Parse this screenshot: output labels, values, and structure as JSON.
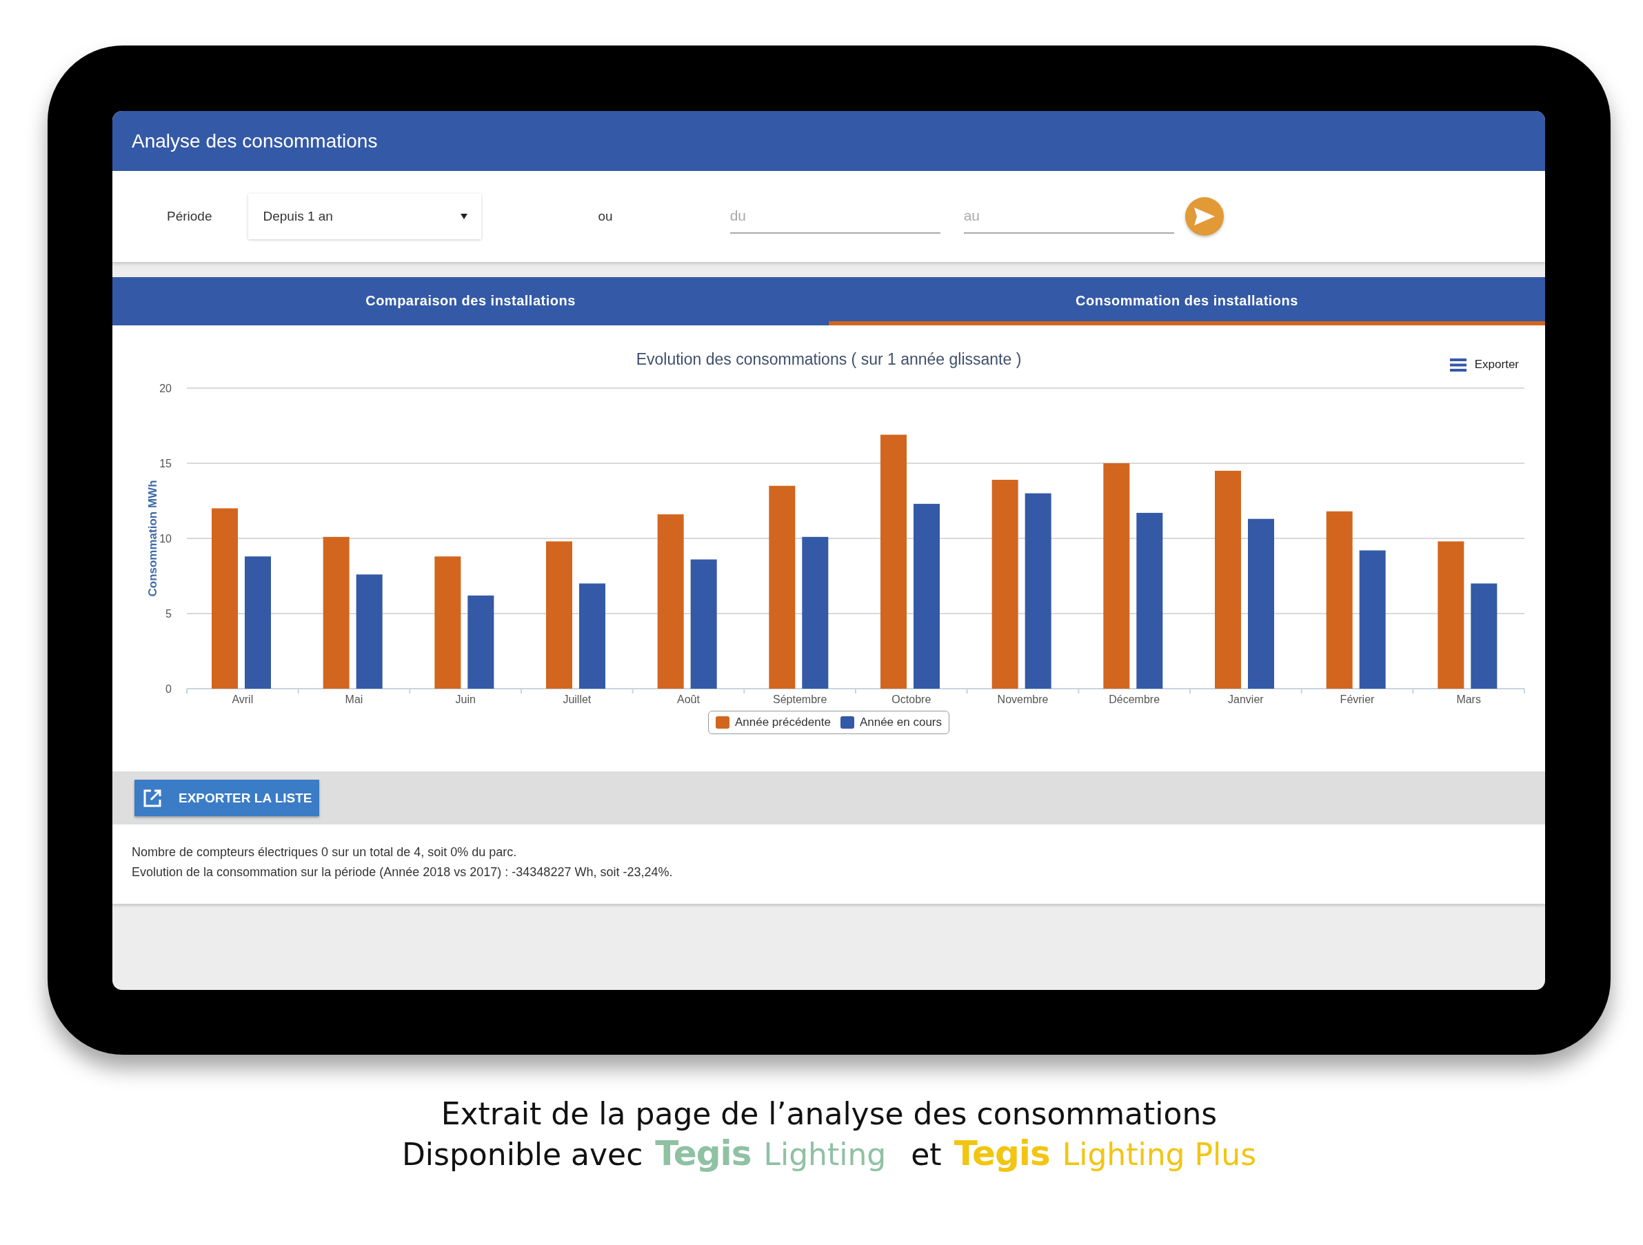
{
  "header": {
    "title": "Analyse des consommations"
  },
  "filters": {
    "period_label": "Période",
    "period_select": {
      "value": "Depuis 1 an"
    },
    "separator": "ou",
    "date_from": {
      "placeholder": "du"
    },
    "date_to": {
      "placeholder": "au"
    }
  },
  "tabs": [
    {
      "label": "Comparaison des installations",
      "selected": false
    },
    {
      "label": "Consommation des installations",
      "selected": true
    }
  ],
  "chart": {
    "export_label": "Exporter",
    "chart_data": {
      "type": "bar",
      "title": "Evolution des consommations ( sur 1 année glissante )",
      "ylabel": "Consommation MWh",
      "categories": [
        "Avril",
        "Mai",
        "Juin",
        "Juillet",
        "Août",
        "Séptembre",
        "Octobre",
        "Novembre",
        "Décembre",
        "Janvier",
        "Février",
        "Mars"
      ],
      "ylim": [
        0,
        20
      ],
      "grid": true,
      "yticks": [
        0,
        5,
        10,
        15,
        20
      ],
      "series": [
        {
          "name": "Année précédente",
          "color": "#d2661f",
          "values": [
            12.0,
            10.1,
            8.8,
            9.8,
            11.6,
            13.5,
            16.9,
            13.9,
            15.0,
            14.5,
            11.8,
            9.8
          ]
        },
        {
          "name": "Année en cours",
          "color": "#3459a6",
          "values": [
            8.8,
            7.6,
            6.2,
            7.0,
            8.6,
            10.1,
            12.3,
            13.0,
            11.7,
            11.3,
            9.2,
            7.0
          ]
        }
      ]
    }
  },
  "export_button": {
    "label": "EXPORTER LA LISTE"
  },
  "summary": [
    "Nombre de compteurs électriques 0 sur un total de 4, soit 0% du parc.",
    "Evolution de la consommation sur la période (Année 2018 vs 2017) : -34348227 Wh, soit -23,24%."
  ],
  "caption": {
    "line_1": "Extrait de la page de l’analyse des consommations",
    "line_2_prefix": "Disponible avec",
    "conjunction": "et",
    "products": [
      {
        "brand": "Tegis",
        "name": "Lighting",
        "color": "#8fc1a3"
      },
      {
        "brand": "Tegis",
        "name": "Lighting Plus",
        "color": "#f2c511"
      }
    ]
  }
}
